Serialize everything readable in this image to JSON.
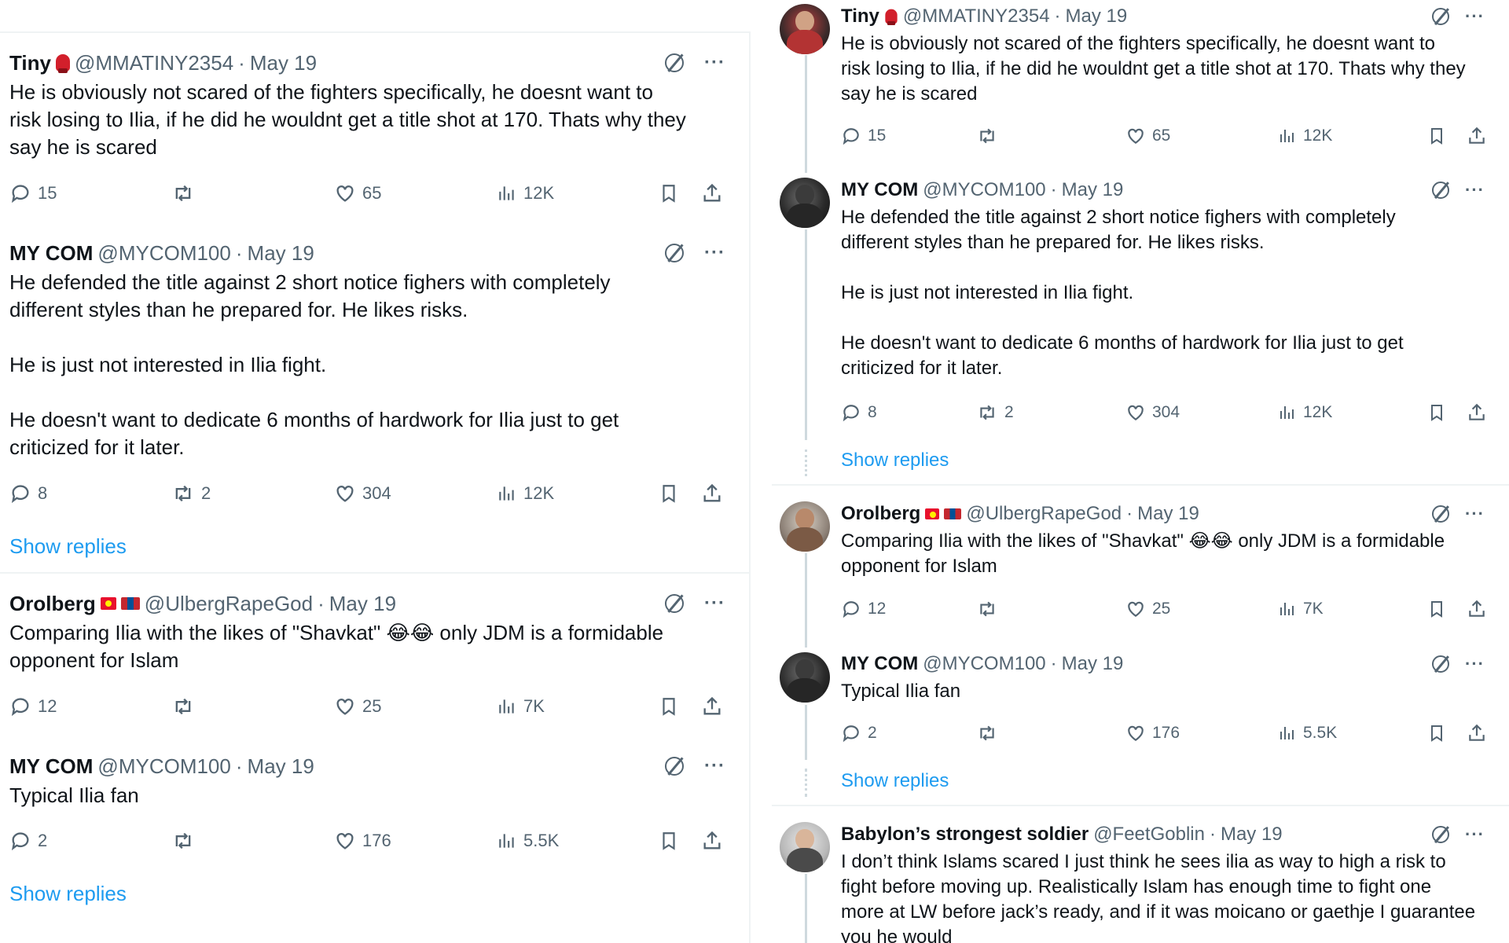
{
  "left": {
    "tweets": [
      {
        "name": "Tiny",
        "handle": "@MMATINY2354",
        "date": "May 19",
        "badge": "glove",
        "text": "He is obviously not scared of the fighters specifically, he doesnt want to\nrisk losing to Ilia, if he did he wouldnt get a title shot at 170. Thats why they\nsay he is scared",
        "replies": "15",
        "reposts": "",
        "likes": "65",
        "views": "12K"
      },
      {
        "name": "MY COM",
        "handle": "@MYCOM100",
        "date": "May 19",
        "badge": "",
        "text": "He defended the title against 2 short notice fighers with completely\ndifferent styles than he prepared for. He likes risks.\n\nHe is just not interested in Ilia fight.\n\nHe doesn't want to dedicate 6 months of hardwork for Ilia just to get\ncriticized for it later.",
        "replies": "8",
        "reposts": "2",
        "likes": "304",
        "views": "12K"
      },
      {
        "name": "Orolberg",
        "handle": "@UlbergRapeGod",
        "date": "May 19",
        "badge": "flags",
        "text": "Comparing Ilia with the likes of \"Shavkat\" 😂😂 only JDM is a formidable\nopponent for Islam",
        "replies": "12",
        "reposts": "",
        "likes": "25",
        "views": "7K"
      },
      {
        "name": "MY COM",
        "handle": "@MYCOM100",
        "date": "May 19",
        "badge": "",
        "text": "Typical Ilia fan",
        "replies": "2",
        "reposts": "",
        "likes": "176",
        "views": "5.5K"
      }
    ],
    "show_replies_1": "Show replies",
    "show_replies_2": "Show replies"
  },
  "right": {
    "tweets": [
      {
        "name": "Tiny",
        "handle": "@MMATINY2354",
        "date": "May 19",
        "badge": "glove",
        "text": "He is obviously not scared of the fighters specifically, he doesnt want to\nrisk losing to Ilia, if he did he wouldnt get a title shot at 170. Thats why they\nsay he is scared",
        "replies": "15",
        "reposts": "",
        "likes": "65",
        "views": "12K"
      },
      {
        "name": "MY COM",
        "handle": "@MYCOM100",
        "date": "May 19",
        "badge": "",
        "text": "He defended the title against 2 short notice fighers with completely\ndifferent styles than he prepared for. He likes risks.\n\nHe is just not interested in Ilia fight.\n\nHe doesn't want to dedicate 6 months of hardwork for Ilia just to get\ncriticized for it later.",
        "replies": "8",
        "reposts": "2",
        "likes": "304",
        "views": "12K"
      },
      {
        "name": "Orolberg",
        "handle": "@UlbergRapeGod",
        "date": "May 19",
        "badge": "flags",
        "text": "Comparing Ilia with the likes of \"Shavkat\" 😂😂 only JDM is a formidable\nopponent for Islam",
        "replies": "12",
        "reposts": "",
        "likes": "25",
        "views": "7K"
      },
      {
        "name": "MY COM",
        "handle": "@MYCOM100",
        "date": "May 19",
        "badge": "",
        "text": "Typical Ilia fan",
        "replies": "2",
        "reposts": "",
        "likes": "176",
        "views": "5.5K"
      },
      {
        "name": "Babylon’s strongest soldier",
        "handle": "@FeetGoblin",
        "date": "May 19",
        "badge": "",
        "text": "I don’t think Islams scared I just think he sees ilia as way to high a risk to\nfight before moving up. Realistically Islam has enough time to fight one\nmore at LW before jack’s ready, and if it was moicano or gaethje I guarantee\nyou he would"
      }
    ],
    "show_replies_1": "Show replies",
    "show_replies_2": "Show replies"
  },
  "separator": "·",
  "more": "···",
  "icons": [
    "reply-icon",
    "repost-icon",
    "like-icon",
    "views-icon",
    "bookmark-icon",
    "share-icon",
    "grok-icon",
    "more-icon"
  ],
  "colors": {
    "link": "#1d9bf0",
    "muted": "#536471",
    "text": "#0f1419",
    "line": "#cfd9de",
    "divider": "#eff3f4"
  }
}
